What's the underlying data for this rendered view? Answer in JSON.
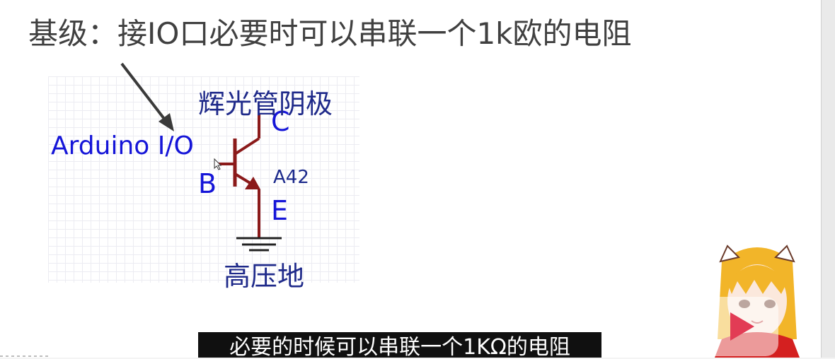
{
  "slide": {
    "title": "基级：接IO口必要时可以串联一个1k欧的电阻"
  },
  "diagram": {
    "io_label": "Arduino I/O",
    "pin_b": "B",
    "pin_c": "C",
    "pin_e": "E",
    "part": "A42",
    "collector_note": "辉光管阴极",
    "ground_note": "高压地",
    "colors": {
      "wire": "#8b1a1a",
      "label": "#1515d8",
      "grid": "#ececf2"
    }
  },
  "caption": {
    "text": "必要的时候可以串联一个1KΩ的电阻"
  },
  "icons": {
    "play": "play-button-icon",
    "avatar": "avatar-character-icon",
    "arrow": "pointer-arrow-icon"
  }
}
